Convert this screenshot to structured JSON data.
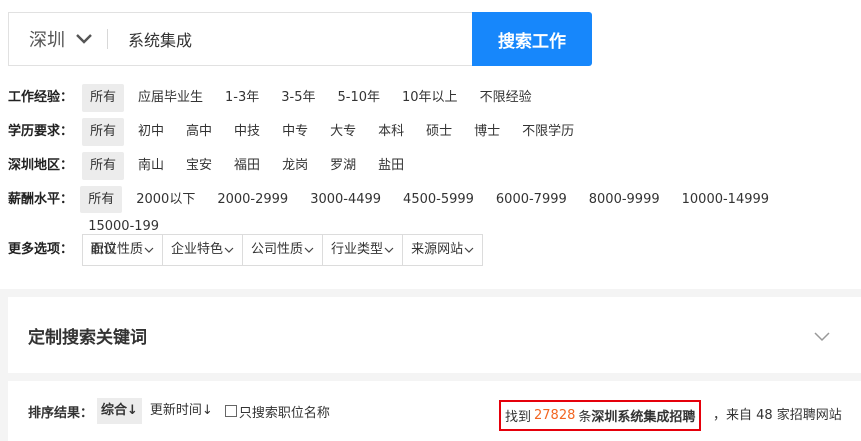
{
  "search": {
    "city": "深圳",
    "keyword": "系统集成",
    "button_label": "搜索工作"
  },
  "filters": {
    "experience": {
      "label": "工作经验：",
      "options": [
        "所有",
        "应届毕业生",
        "1-3年",
        "3-5年",
        "5-10年",
        "10年以上",
        "不限经验"
      ]
    },
    "education": {
      "label": "学历要求：",
      "options": [
        "所有",
        "初中",
        "高中",
        "中技",
        "中专",
        "大专",
        "本科",
        "硕士",
        "博士",
        "不限学历"
      ]
    },
    "district": {
      "label": "深圳地区：",
      "options": [
        "所有",
        "南山",
        "宝安",
        "福田",
        "龙岗",
        "罗湖",
        "盐田"
      ]
    },
    "salary": {
      "label": "薪酬水平：",
      "options": [
        "所有",
        "2000以下",
        "2000-2999",
        "3000-4499",
        "4500-5999",
        "6000-7999",
        "8000-9999",
        "10000-14999",
        "15000-199"
      ],
      "wrap_option": "面议"
    },
    "more": {
      "label": "更多选项：",
      "options": [
        "职位性质",
        "企业特色",
        "公司性质",
        "行业类型",
        "来源网站"
      ]
    }
  },
  "custom_keywords": {
    "title": "定制搜索关键词"
  },
  "sort": {
    "label": "排序结果：",
    "options": [
      "综合↓",
      "更新时间↓"
    ],
    "checkbox_label": "只搜索职位名称"
  },
  "result": {
    "prefix": "找到",
    "count": "27828",
    "middle": "条",
    "keyword": "深圳系统集成招聘",
    "suffix": "，来自 48 家招聘网站"
  },
  "colors": {
    "accent": "#1787fb",
    "count": "#f26622",
    "highlight_border": "#e5000b"
  }
}
